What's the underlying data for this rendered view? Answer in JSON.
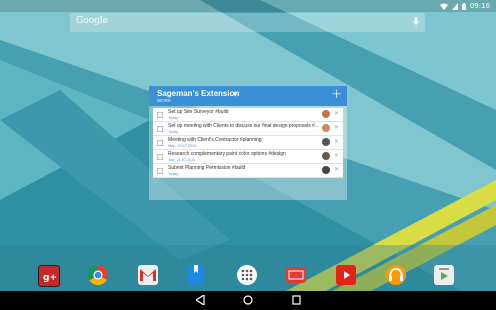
{
  "status": {
    "time": "09:16"
  },
  "search": {
    "brand": "Google"
  },
  "widget": {
    "title": "Sageman's Extension",
    "subtitle": "WORK",
    "tasks": [
      {
        "title": "Set up Site Surveyor #build",
        "date": "Today"
      },
      {
        "title": "Set up meeting with Clients to discuss our final design proposals #...",
        "date": "Today"
      },
      {
        "title": "Meeting with Client's Contractor #planning",
        "date": "Mon, 20.07.2015"
      },
      {
        "title": "Research complementary paint color options #design",
        "date": "Tue, 21.07.2015"
      },
      {
        "title": "Submit Planning Permission #build",
        "date": "Today"
      }
    ]
  },
  "dock": {
    "apps": [
      "google-plus",
      "chrome",
      "gmail",
      "books",
      "app-drawer",
      "slides",
      "youtube",
      "music",
      "play-store"
    ]
  },
  "colors": {
    "accent": "#3a8fd6",
    "wallpaper": "#4aa3b4"
  }
}
